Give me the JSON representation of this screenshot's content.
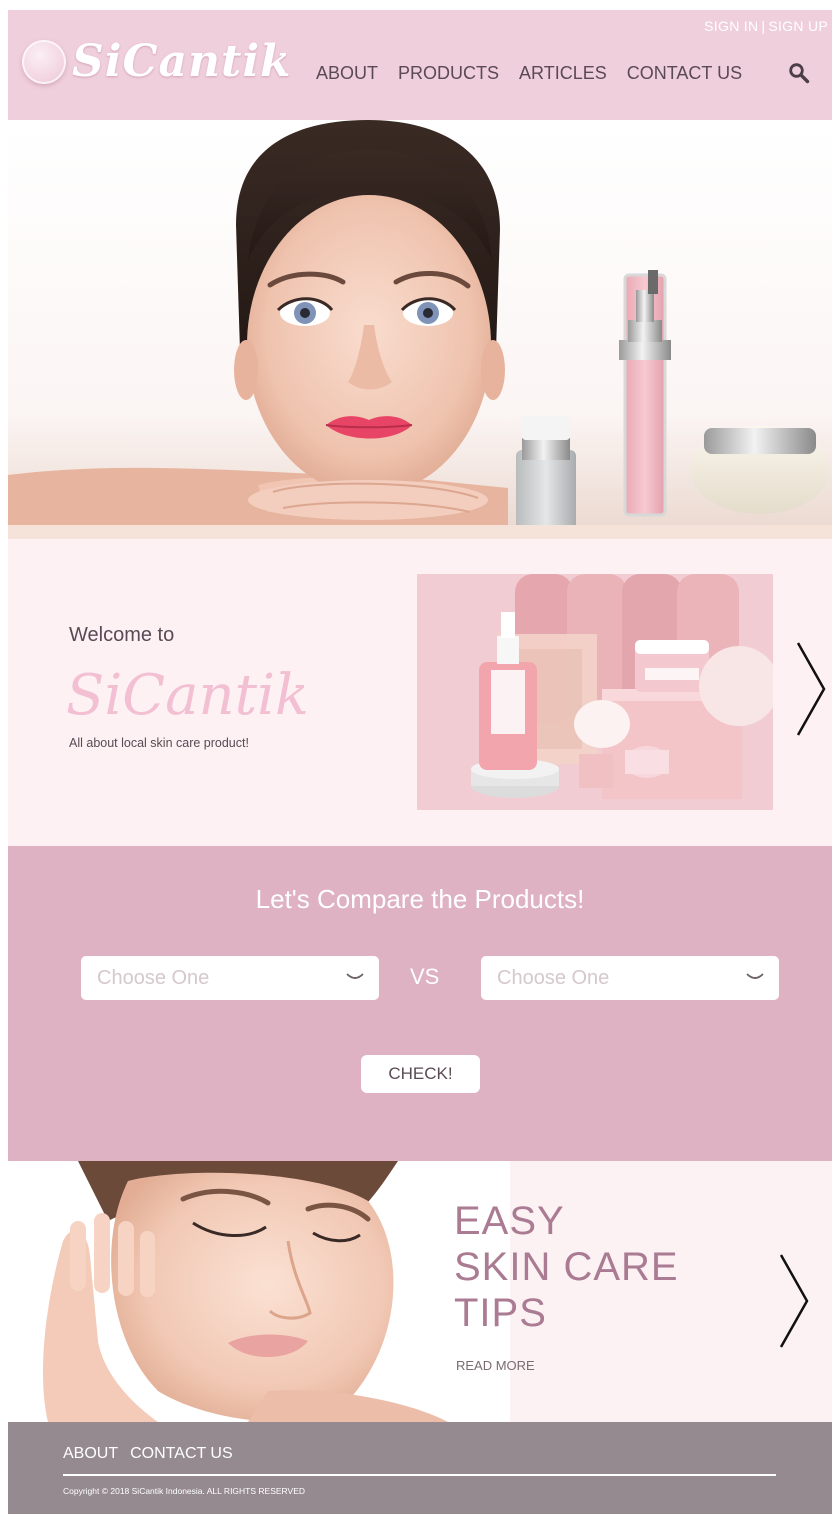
{
  "header": {
    "logo_text": "SiCantik",
    "auth": {
      "sign_in": "SIGN IN",
      "separator": "|",
      "sign_up": "SIGN UP"
    },
    "nav": [
      {
        "label": "ABOUT"
      },
      {
        "label": "PRODUCTS"
      },
      {
        "label": "ARTICLES"
      },
      {
        "label": "CONTACT US"
      }
    ],
    "search_icon": "search-icon"
  },
  "hero": {
    "image": "model-with-skincare-bottles-photo"
  },
  "welcome": {
    "pre": "Welcome to",
    "brand": "SiCantik",
    "subtitle": "All about local skin care product!",
    "next_icon": "chevron-right-icon"
  },
  "compare": {
    "title": "Let's Compare the Products!",
    "left_placeholder": "Choose One",
    "vs": "VS",
    "right_placeholder": "Choose One",
    "check_label": "CHECK!"
  },
  "tips": {
    "title_lines": [
      "EASY",
      "SKIN CARE",
      "TIPS"
    ],
    "read_more": "READ MORE",
    "next_icon": "chevron-right-icon"
  },
  "footer": {
    "links": [
      {
        "label": "ABOUT"
      },
      {
        "label": "CONTACT US"
      }
    ],
    "copyright": "Copyright © 2018 SiCantik Indonesia. ALL RIGHTS RESERVED"
  },
  "colors": {
    "header_bg": "#f0cfdc",
    "welcome_bg": "#fdf1f3",
    "compare_bg": "#deb1c3",
    "tips_title": "#aa7b92",
    "footer_bg": "#958a8f"
  }
}
